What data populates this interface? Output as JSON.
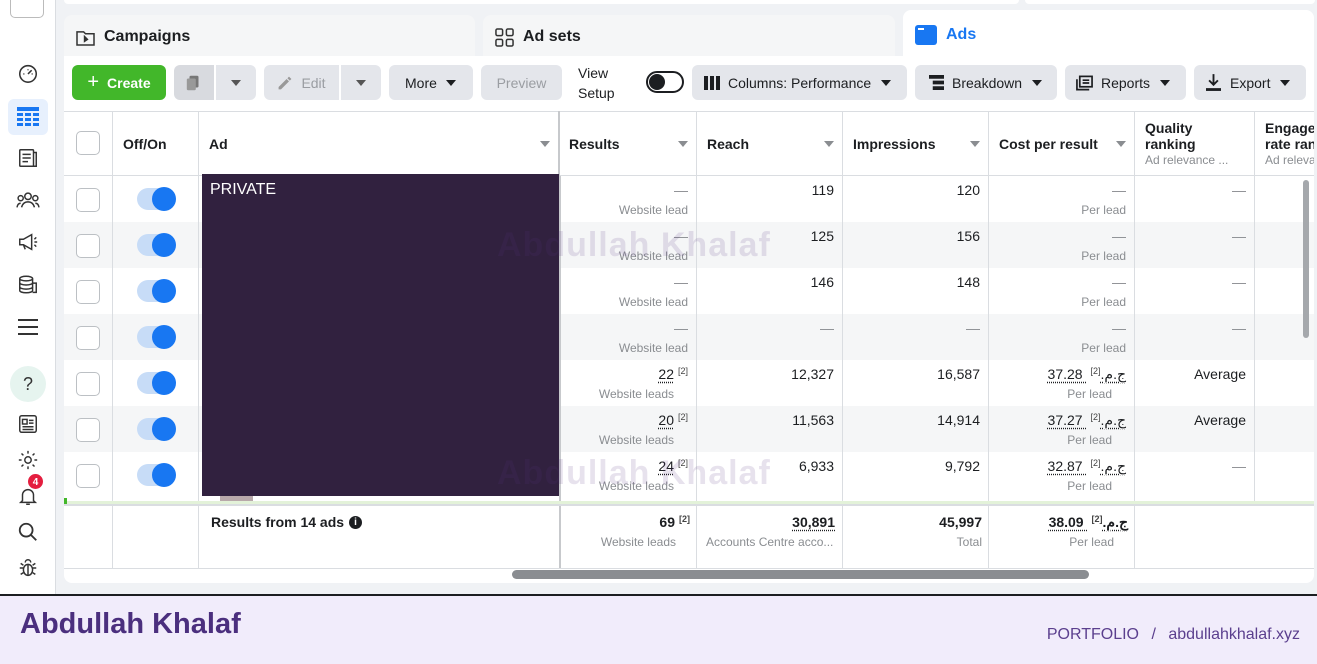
{
  "tabs": [
    {
      "label": "Campaigns",
      "icon": "folder-icon"
    },
    {
      "label": "Ad sets",
      "icon": "grid-icon"
    },
    {
      "label": "Ads",
      "icon": "ads-icon"
    }
  ],
  "toolbar": {
    "create": "Create",
    "edit": "Edit",
    "more": "More",
    "preview": "Preview",
    "view_setup": "View Setup",
    "columns": "Columns: Performance",
    "breakdown": "Breakdown",
    "reports": "Reports",
    "export": "Export"
  },
  "headers": {
    "offon": "Off/On",
    "ad": "Ad",
    "results": "Results",
    "reach": "Reach",
    "impressions": "Impressions",
    "cost": "Cost per result",
    "quality": "Quality ranking",
    "quality_sub": "Ad relevance ...",
    "engagement": "Engager rate ran",
    "engagement_sub": "Ad releva"
  },
  "private_label": "PRIVATE",
  "rows": [
    {
      "results": "—",
      "results_sub": "Website lead",
      "reach": "119",
      "impressions": "120",
      "cost": "—",
      "cost_sub": "Per lead",
      "quality": "—"
    },
    {
      "results": "—",
      "results_sub": "Website lead",
      "reach": "125",
      "impressions": "156",
      "cost": "—",
      "cost_sub": "Per lead",
      "quality": "—"
    },
    {
      "results": "—",
      "results_sub": "Website lead",
      "reach": "146",
      "impressions": "148",
      "cost": "—",
      "cost_sub": "Per lead",
      "quality": "—"
    },
    {
      "results": "—",
      "results_sub": "Website lead",
      "reach": "—",
      "impressions": "—",
      "cost": "—",
      "cost_sub": "Per lead",
      "quality": "—"
    },
    {
      "results": "22",
      "results_sup": "[2]",
      "results_sub": "Website leads",
      "reach": "12,327",
      "impressions": "16,587",
      "cost": "37.28 ج.م.",
      "cost_sup": "[2]",
      "cost_sub": "Per lead",
      "quality": "Average"
    },
    {
      "results": "20",
      "results_sup": "[2]",
      "results_sub": "Website leads",
      "reach": "11,563",
      "impressions": "14,914",
      "cost": "37.27 ج.م.",
      "cost_sup": "[2]",
      "cost_sub": "Per lead",
      "quality": "Average"
    },
    {
      "results": "24",
      "results_sup": "[2]",
      "results_sub": "Website leads",
      "reach": "6,933",
      "impressions": "9,792",
      "cost": "32.87 ج.م.",
      "cost_sup": "[2]",
      "cost_sub": "Per lead",
      "quality": "—"
    }
  ],
  "summary": {
    "label": "Results from 14 ads",
    "results": "69",
    "results_sup": "[2]",
    "results_sub": "Website leads",
    "reach": "30,891",
    "reach_sub": "Accounts Centre acco...",
    "impressions": "45,997",
    "impressions_sub": "Total",
    "cost": "38.09 ج.م.",
    "cost_sup": "[2]",
    "cost_sub": "Per lead"
  },
  "watermark": "Abdullah Khalaf",
  "sidebar": {
    "notification_count": "4"
  },
  "footer": {
    "name": "Abdullah Khalaf",
    "portfolio": "PORTFOLIO",
    "sep": "/",
    "site": "abdullahkhalaf.xyz"
  },
  "colors": {
    "accent": "#1877f2",
    "create": "#42b72a",
    "private_block": "#31213f",
    "footer_bg": "#f1ecfb",
    "footer_text": "#4b2f7e"
  }
}
